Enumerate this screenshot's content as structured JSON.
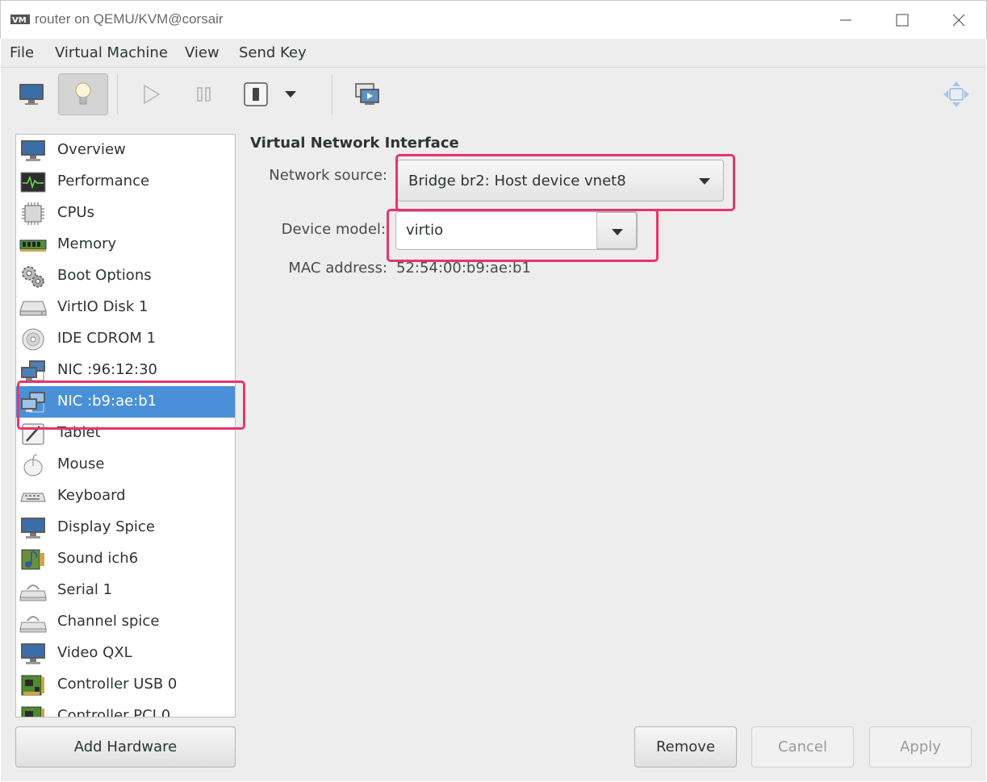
{
  "window": {
    "title": "router on QEMU/KVM@corsair"
  },
  "menu": [
    "File",
    "Virtual Machine",
    "View",
    "Send Key"
  ],
  "sidebar": {
    "items": [
      {
        "label": "Overview",
        "icon": "monitor-icon"
      },
      {
        "label": "Performance",
        "icon": "performance-icon"
      },
      {
        "label": "CPUs",
        "icon": "cpu-icon"
      },
      {
        "label": "Memory",
        "icon": "memory-icon"
      },
      {
        "label": "Boot Options",
        "icon": "gears-icon"
      },
      {
        "label": "VirtIO Disk 1",
        "icon": "disk-icon"
      },
      {
        "label": "IDE CDROM 1",
        "icon": "cdrom-icon"
      },
      {
        "label": "NIC :96:12:30",
        "icon": "network-icon"
      },
      {
        "label": "NIC :b9:ae:b1",
        "icon": "network-icon"
      },
      {
        "label": "Tablet",
        "icon": "tablet-icon"
      },
      {
        "label": "Mouse",
        "icon": "mouse-icon"
      },
      {
        "label": "Keyboard",
        "icon": "keyboard-icon"
      },
      {
        "label": "Display Spice",
        "icon": "display-icon"
      },
      {
        "label": "Sound ich6",
        "icon": "sound-icon"
      },
      {
        "label": "Serial 1",
        "icon": "serial-icon"
      },
      {
        "label": "Channel spice",
        "icon": "channel-icon"
      },
      {
        "label": "Video QXL",
        "icon": "video-icon"
      },
      {
        "label": "Controller USB 0",
        "icon": "controller-icon"
      },
      {
        "label": "Controller PCI 0",
        "icon": "controller-icon"
      }
    ],
    "selected_index": 8
  },
  "detail": {
    "title": "Virtual Network Interface",
    "network_source_label": "Network source:",
    "network_source_value": "Bridge br2: Host device vnet8",
    "device_model_label": "Device model:",
    "device_model_value": "virtio",
    "mac_label": "MAC address:",
    "mac_value": "52:54:00:b9:ae:b1"
  },
  "buttons": {
    "add_hardware": "Add Hardware",
    "remove": "Remove",
    "cancel": "Cancel",
    "apply": "Apply"
  },
  "colors": {
    "selection": "#4a90d9",
    "highlight": "#e8356a"
  }
}
